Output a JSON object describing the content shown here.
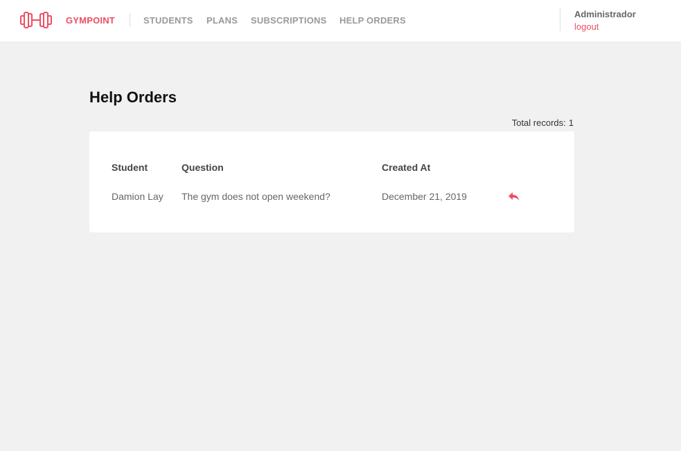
{
  "header": {
    "brand": "GYMPOINT",
    "nav": [
      {
        "label": "STUDENTS"
      },
      {
        "label": "PLANS"
      },
      {
        "label": "SUBSCRIPTIONS"
      },
      {
        "label": "HELP ORDERS"
      }
    ],
    "user_name": "Administrador",
    "logout_label": "logout"
  },
  "main": {
    "title": "Help Orders",
    "total_label": "Total records:",
    "total_value": 1,
    "table": {
      "columns": [
        "Student",
        "Question",
        "Created At"
      ],
      "rows": [
        {
          "student": "Damion Lay",
          "question": "The gym does not open weekend?",
          "created_at": "December 21, 2019",
          "action_icon": "reply-icon"
        }
      ]
    }
  },
  "colors": {
    "accent": "#ee4d64",
    "background": "#f1f1f1",
    "nav_inactive": "#999999"
  },
  "icons": {
    "logo": "dumbbell-icon",
    "row_action": "reply-icon"
  }
}
